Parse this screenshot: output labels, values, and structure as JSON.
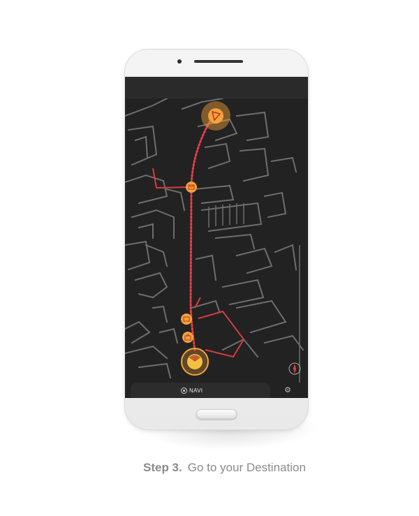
{
  "app": {
    "bottom_bar": {
      "navi_label": "NAVI"
    },
    "icons": {
      "destination": "pizza-icon",
      "waypoint_1": "mail-icon",
      "waypoint_2": "image-icon",
      "waypoint_3": "shopping-bag-icon",
      "current_position": "location-icon",
      "compass": "compass-icon",
      "settings": "settings-icon",
      "navi": "radio-button-icon"
    }
  },
  "caption": {
    "step": "Step 3.",
    "text": "Go to your Destination"
  },
  "colors": {
    "screen_bg": "#222222",
    "map_lines": "#7a7a7a",
    "route": "#e0404a",
    "marker": "#f4a23a",
    "caption": "#8a8a8a"
  }
}
